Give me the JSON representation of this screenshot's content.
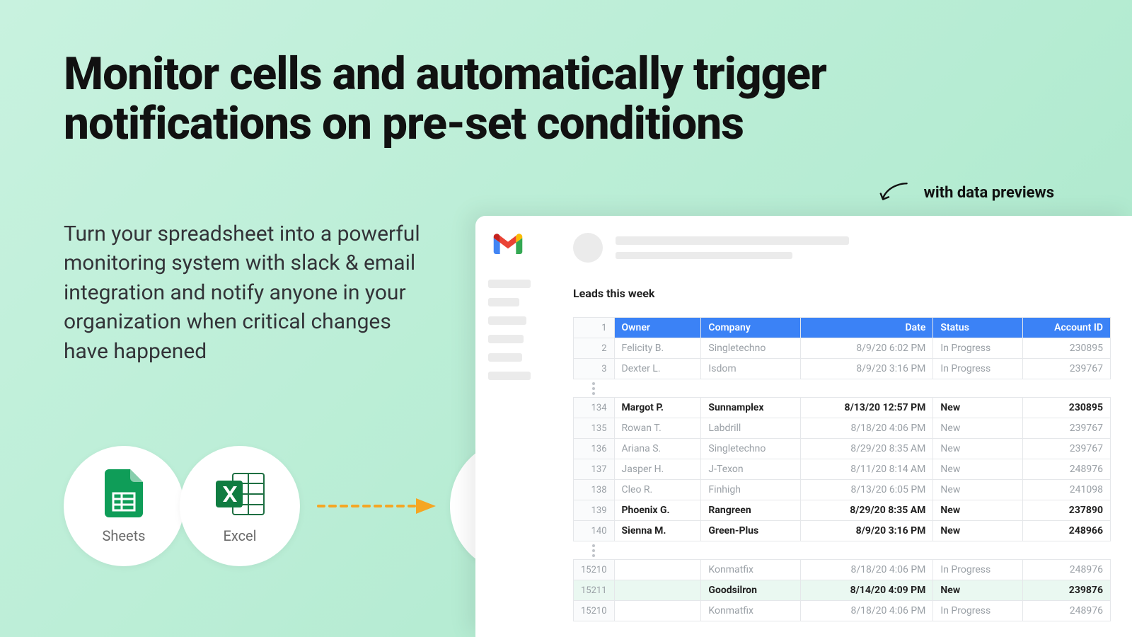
{
  "headline": "Monitor cells and automatically trigger notifications on pre-set conditions",
  "subhead": "Turn your spreadsheet into a powerful monitoring system with slack & email integration and notify anyone in your organization when critical changes have happened",
  "callout": "with data previews",
  "icons": {
    "sheets": "Sheets",
    "excel": "Excel"
  },
  "preview": {
    "title": "Leads this week",
    "columns": [
      "Owner",
      "Company",
      "Date",
      "Status",
      "Account ID"
    ],
    "block1": [
      {
        "n": "1",
        "header": true
      },
      {
        "n": "2",
        "owner": "Felicity B.",
        "company": "Singletechno",
        "date": "8/9/20 6:02 PM",
        "status": "In Progress",
        "acct": "230895"
      },
      {
        "n": "3",
        "owner": "Dexter L.",
        "company": "Isdom",
        "date": "8/9/20 3:16 PM",
        "status": "In Progress",
        "acct": "239767"
      }
    ],
    "block2": [
      {
        "n": "134",
        "owner": "Margot P.",
        "company": "Sunnamplex",
        "date": "8/13/20 12:57 PM",
        "status": "New",
        "acct": "230895",
        "bold": true
      },
      {
        "n": "135",
        "owner": "Rowan T.",
        "company": "Labdrill",
        "date": "8/18/20 4:06 PM",
        "status": "New",
        "acct": "239767"
      },
      {
        "n": "136",
        "owner": "Ariana S.",
        "company": "Singletechno",
        "date": "8/29/20 8:35 AM",
        "status": "New",
        "acct": "239767"
      },
      {
        "n": "137",
        "owner": "Jasper H.",
        "company": "J-Texon",
        "date": "8/11/20 8:14 AM",
        "status": "New",
        "acct": "248976"
      },
      {
        "n": "138",
        "owner": "Cleo R.",
        "company": "Finhigh",
        "date": "8/13/20 6:05 PM",
        "status": "New",
        "acct": "241098"
      },
      {
        "n": "139",
        "owner": "Phoenix G.",
        "company": "Rangreen",
        "date": "8/29/20 8:35 AM",
        "status": "New",
        "acct": "237890",
        "bold": true
      },
      {
        "n": "140",
        "owner": "Sienna M.",
        "company": "Green-Plus",
        "date": "8/9/20 3:16 PM",
        "status": "New",
        "acct": "248966",
        "bold": true
      }
    ],
    "block3": [
      {
        "n": "15210",
        "owner": "",
        "company": "Konmatfix",
        "date": "8/18/20 4:06 PM",
        "status": "In Progress",
        "acct": "248976"
      },
      {
        "n": "15211",
        "owner": "",
        "company": "Goodsilron",
        "date": "8/14/20 4:09 PM",
        "status": "New",
        "acct": "239876",
        "bold": true,
        "hl": true
      },
      {
        "n": "15210",
        "owner": "",
        "company": "Konmatfix",
        "date": "8/18/20 4:06 PM",
        "status": "In Progress",
        "acct": "248976"
      }
    ]
  }
}
